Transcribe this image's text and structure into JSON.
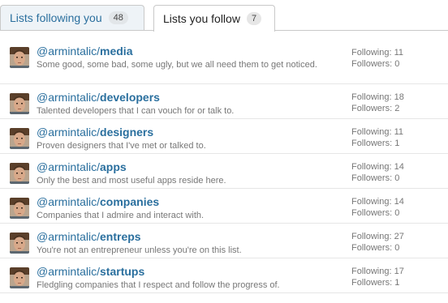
{
  "tabs": [
    {
      "label": "Lists following you",
      "count": "48"
    },
    {
      "label": "Lists you follow",
      "count": "7"
    }
  ],
  "stat_labels": {
    "following": "Following:",
    "followers": "Followers:"
  },
  "lists": [
    {
      "owner": "@armintalic/",
      "slug": "media",
      "description": "Some good, some bad, some ugly, but we all need them to get noticed.",
      "following": "11",
      "followers": "0"
    },
    {
      "owner": "@armintalic/",
      "slug": "developers",
      "description": "Talented developers that I can vouch for or talk to.",
      "following": "18",
      "followers": "2"
    },
    {
      "owner": "@armintalic/",
      "slug": "designers",
      "description": "Proven designers that I've met or talked to.",
      "following": "11",
      "followers": "1"
    },
    {
      "owner": "@armintalic/",
      "slug": "apps",
      "description": "Only the best and most useful apps reside here.",
      "following": "14",
      "followers": "0"
    },
    {
      "owner": "@armintalic/",
      "slug": "companies",
      "description": "Companies that I admire and interact with.",
      "following": "14",
      "followers": "0"
    },
    {
      "owner": "@armintalic/",
      "slug": "entreps",
      "description": "You're not an entrepreneur unless you're on this list.",
      "following": "27",
      "followers": "0"
    },
    {
      "owner": "@armintalic/",
      "slug": "startups",
      "description": "Fledgling companies that I respect and follow the progress of.",
      "following": "17",
      "followers": "1"
    }
  ]
}
